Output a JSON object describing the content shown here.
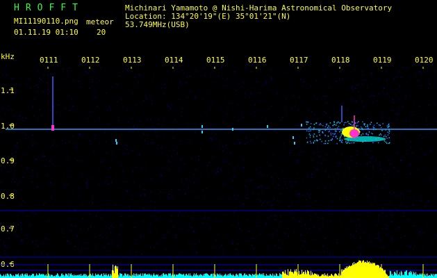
{
  "header": {
    "brand": "HROFFT",
    "filename": "MI11190110.png",
    "datetime": "01.11.19 01:10",
    "event_label": "meteor",
    "event_count": "20",
    "observer": "Michinari Yamamoto @ Nishi-Harima Astronomical Observatory",
    "location": "Location: 134°20'19\"(E) 35°01'21\"(N)",
    "frequency": "53.749MHz(USB)"
  },
  "time_axis": {
    "labels": [
      "0111",
      "0112",
      "0113",
      "0114",
      "0115",
      "0116",
      "0117",
      "0118",
      "0119",
      "0120"
    ]
  },
  "freq_axis": {
    "unit": "kHz",
    "labels": [
      "1.1",
      "1.0",
      "0.9",
      "0.8",
      "0.7",
      "0.6"
    ]
  },
  "colors": {
    "background": "#000000",
    "text_yellow": "#ffff33",
    "text_green": "#33ff66",
    "carrier": "#3399ff",
    "noise_blue": "#0000cc",
    "signal_cyan": "#00ffff",
    "signal_yellow": "#ffff00",
    "signal_magenta": "#ff33cc"
  }
}
